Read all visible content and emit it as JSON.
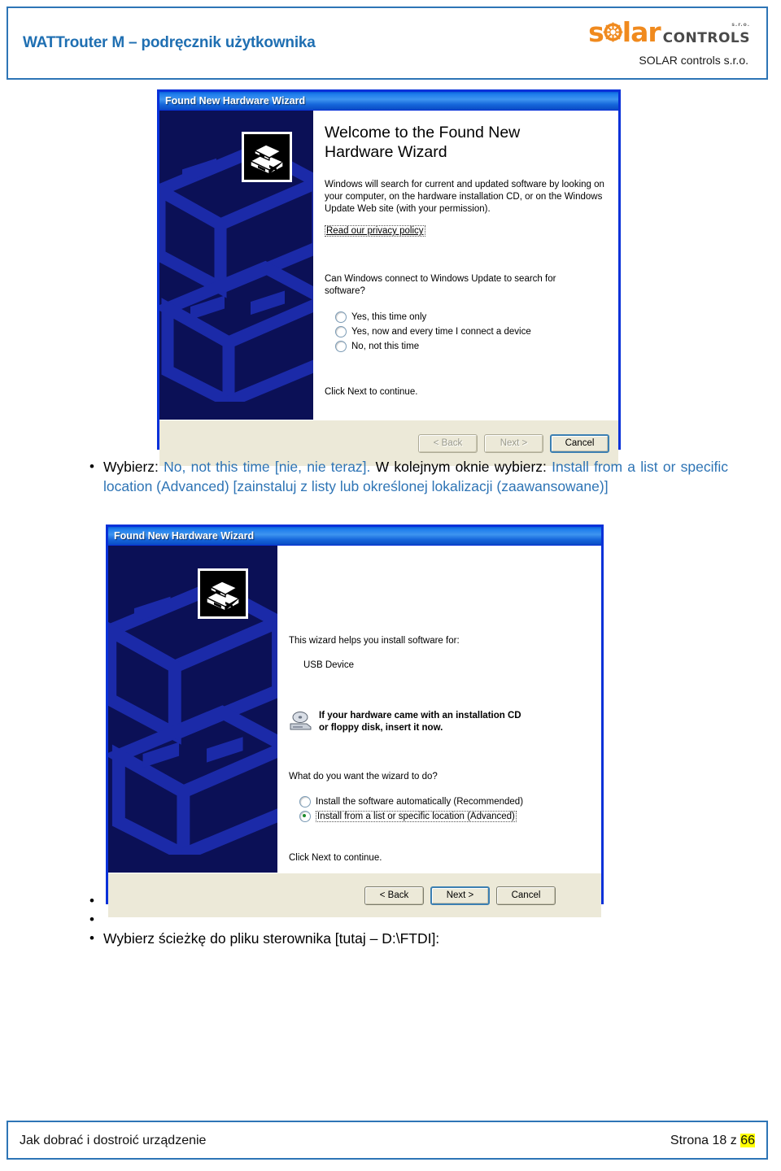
{
  "header": {
    "doc_title": "WATTrouter M – podręcznik użytkownika",
    "logo": {
      "word_s": "s",
      "sun_icon": "sun-gear-icon",
      "word_lar": "lar",
      "word_controls": "CONTROLS",
      "superscript": "s.r.o.",
      "company": "SOLAR controls s.r.o."
    },
    "border_color": "#2E75B6",
    "title_color": "#1F6FB2",
    "logo_orange": "#F08A1E"
  },
  "dialog1": {
    "titlebar": "Found New Hardware Wizard",
    "heading": "Welcome to the Found New Hardware Wizard",
    "paragraph": "Windows will search for current and updated software by looking on your computer, on the hardware installation CD, or on the Windows Update Web site (with your permission).",
    "privacy_link": "Read our privacy policy",
    "question": "Can Windows connect to Windows Update to search for software?",
    "options": [
      {
        "label": "Yes, this time only",
        "accel": "Y",
        "checked": false
      },
      {
        "label": "Yes, now and every time I connect a device",
        "accel": "e",
        "checked": false
      },
      {
        "label": "No, not this time",
        "accel": "t",
        "checked": false
      }
    ],
    "hint": "Click Next to continue.",
    "buttons": [
      {
        "label": "< Back",
        "state": "disabled"
      },
      {
        "label": "Next >",
        "state": "disabled"
      },
      {
        "label": "Cancel",
        "state": "default"
      }
    ]
  },
  "bullet1": {
    "marker": "•",
    "seg1": "Wybierz: ",
    "seg2": "No, not this time [nie, nie teraz].",
    "seg3": " W kolejnym oknie wybierz: ",
    "seg4": "Install from a list or specific location (Advanced) [zainstaluj z listy lub określonej lokalizacji (zaawansowane)]"
  },
  "dialog2": {
    "titlebar": "Found New Hardware Wizard",
    "intro": "This wizard helps you install software for:",
    "device": "USB Device",
    "cd_icon": "cd-drive-icon",
    "cd_note_line1": "If your hardware came with an installation CD",
    "cd_note_line2": "or floppy disk, insert it now.",
    "question": "What do you want the wizard to do?",
    "options": [
      {
        "label": "Install the software automatically (Recommended)",
        "accel": "I",
        "checked": false,
        "focused": false
      },
      {
        "label": "Install from a list or specific location (Advanced)",
        "accel": "s",
        "checked": true,
        "focused": true
      }
    ],
    "hint": "Click Next to continue.",
    "buttons": [
      {
        "label": "< Back",
        "state": "normal"
      },
      {
        "label": "Next >",
        "state": "default"
      },
      {
        "label": "Cancel",
        "state": "normal"
      }
    ]
  },
  "bullet_empty_1": {
    "marker": "•",
    "text": ""
  },
  "bullet_empty_2": {
    "marker": "•",
    "text": ""
  },
  "bullet2": {
    "marker": "•",
    "text": "Wybierz ścieżkę do pliku sterownika [tutaj –  D:\\FTDI]:"
  },
  "footer": {
    "left": "Jak dobrać i dostroić urządzenie",
    "right_prefix": "Strona 18 z ",
    "right_page": "66",
    "highlight_color": "#FFFF00"
  }
}
